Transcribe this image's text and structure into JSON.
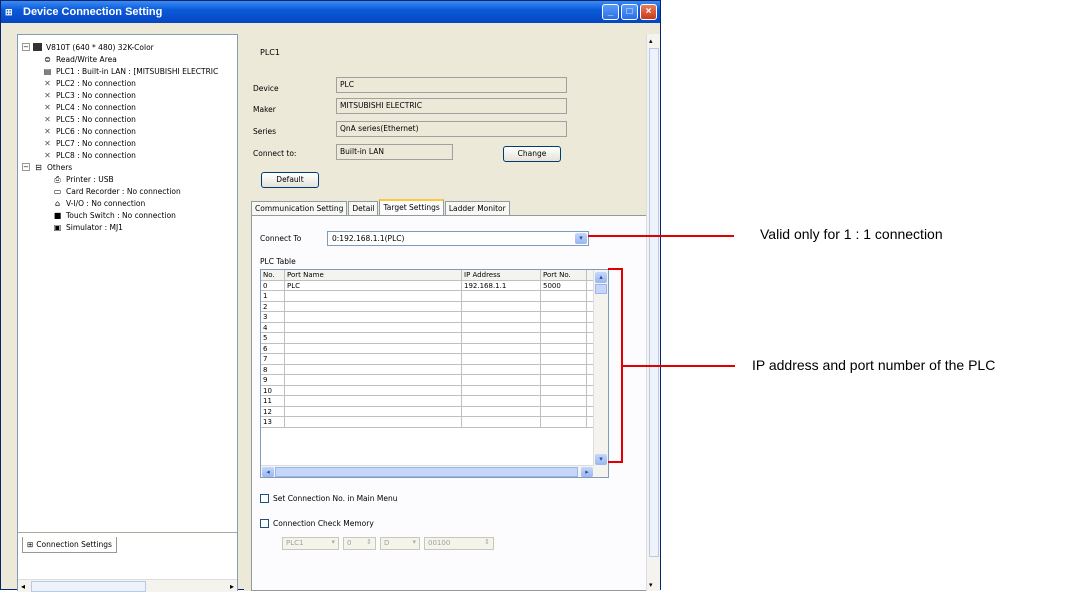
{
  "window": {
    "title": "Device Connection Setting",
    "buttons": [
      "minimize",
      "maximize",
      "close"
    ]
  },
  "tree": {
    "root": "V810T (640 * 480) 32K-Color",
    "items": [
      {
        "label": "Read/Write Area",
        "icon": "read-write-area-icon"
      },
      {
        "label": "PLC1 : Built-in LAN : [MITSUBISHI ELECTRIC",
        "icon": "plc-device-icon"
      },
      {
        "label": "PLC2 : No connection",
        "icon": "no-connection-icon"
      },
      {
        "label": "PLC3 : No connection",
        "icon": "no-connection-icon"
      },
      {
        "label": "PLC4 : No connection",
        "icon": "no-connection-icon"
      },
      {
        "label": "PLC5 : No connection",
        "icon": "no-connection-icon"
      },
      {
        "label": "PLC6 : No connection",
        "icon": "no-connection-icon"
      },
      {
        "label": "PLC7 : No connection",
        "icon": "no-connection-icon"
      },
      {
        "label": "PLC8 : No connection",
        "icon": "no-connection-icon"
      }
    ],
    "others": "Others",
    "others_items": [
      {
        "label": "Printer : USB",
        "icon": "printer-icon"
      },
      {
        "label": "Card Recorder : No connection",
        "icon": "card-recorder-icon"
      },
      {
        "label": "V-I/O : No connection",
        "icon": "vio-icon"
      },
      {
        "label": "Touch Switch : No connection",
        "icon": "touch-switch-icon"
      },
      {
        "label": "Simulator : MJ1",
        "icon": "simulator-icon"
      }
    ]
  },
  "left_tab": "Connection Settings",
  "detail": {
    "title": "PLC1",
    "device_label": "Device",
    "device_value": "PLC",
    "maker_label": "Maker",
    "maker_value": "MITSUBISHI ELECTRIC",
    "series_label": "Series",
    "series_value": "QnA series(Ethernet)",
    "connect_label": "Connect to:",
    "connect_value": "Built-in LAN",
    "change_button": "Change",
    "default_button": "Default"
  },
  "tabs": [
    "Communication Setting",
    "Detail",
    "Target Settings",
    "Ladder Monitor"
  ],
  "active_tab": "Target Settings",
  "target": {
    "connect_to_label": "Connect To",
    "connect_to_value": "0:192.168.1.1(PLC)",
    "plc_table_label": "PLC Table",
    "columns": [
      "No.",
      "Port Name",
      "IP Address",
      "Port No."
    ],
    "rows": [
      [
        "0",
        "PLC",
        "192.168.1.1",
        "5000"
      ],
      [
        "1",
        "",
        "",
        ""
      ],
      [
        "2",
        "",
        "",
        ""
      ],
      [
        "3",
        "",
        "",
        ""
      ],
      [
        "4",
        "",
        "",
        ""
      ],
      [
        "5",
        "",
        "",
        ""
      ],
      [
        "6",
        "",
        "",
        ""
      ],
      [
        "7",
        "",
        "",
        ""
      ],
      [
        "8",
        "",
        "",
        ""
      ],
      [
        "9",
        "",
        "",
        ""
      ],
      [
        "10",
        "",
        "",
        ""
      ],
      [
        "11",
        "",
        "",
        ""
      ],
      [
        "12",
        "",
        "",
        ""
      ],
      [
        "13",
        "",
        "",
        ""
      ]
    ],
    "set_connection_checkbox": "Set Connection No. in Main Menu",
    "check_memory_checkbox": "Connection Check Memory",
    "memory_plc": "PLC1",
    "memory_num": "0",
    "memory_device": "D",
    "memory_address": "00100"
  },
  "annotations": {
    "connect_note": "Valid only for 1 : 1 connection",
    "table_note": "IP address and port number of the PLC"
  },
  "colors": {
    "callout": "#e00000",
    "titlebar": "#0b5ad9"
  }
}
